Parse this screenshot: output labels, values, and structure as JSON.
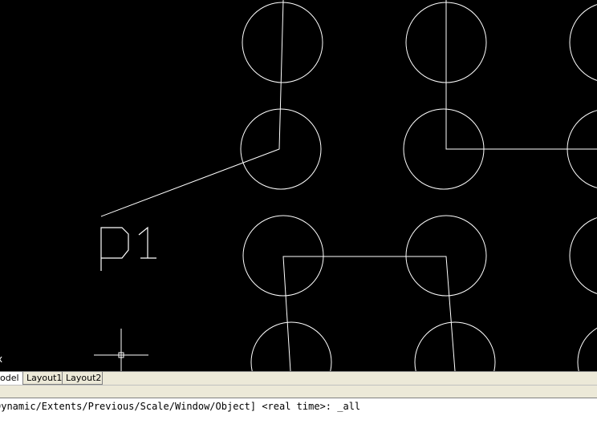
{
  "drawing": {
    "label_text": "p1",
    "background": "#000000",
    "stroke": "#ffffff",
    "axis_glyph": "x"
  },
  "tabs": [
    {
      "label": "odel",
      "active": true
    },
    {
      "label": "Layout1",
      "active": false
    },
    {
      "label": "Layout2",
      "active": false
    }
  ],
  "command_line": {
    "text": "Dynamic/Extents/Previous/Scale/Window/Object] <real time>: _all"
  }
}
